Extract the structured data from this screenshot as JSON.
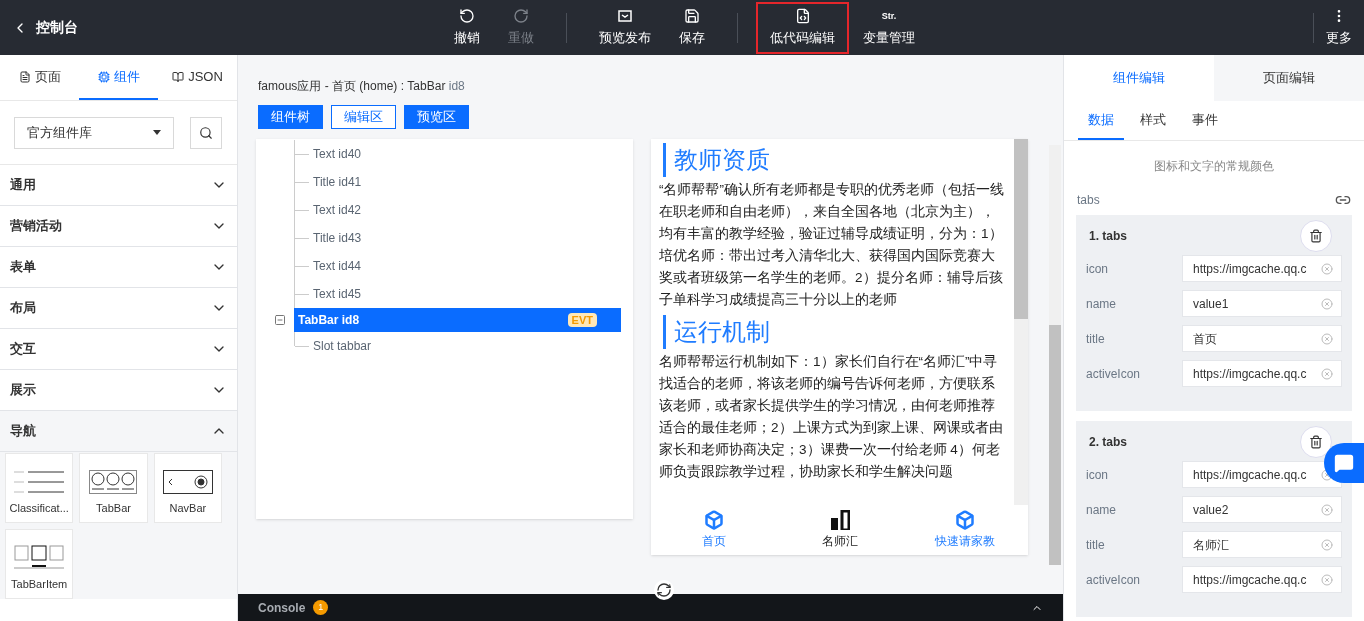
{
  "header": {
    "back_label": "控制台",
    "tools": [
      {
        "label": "撤销",
        "disabled": false,
        "highlighted": false
      },
      {
        "label": "重做",
        "disabled": true,
        "highlighted": false
      },
      {
        "label": "预览发布",
        "disabled": false,
        "highlighted": false
      },
      {
        "label": "保存",
        "disabled": false,
        "highlighted": false
      },
      {
        "label": "低代码编辑",
        "disabled": false,
        "highlighted": true
      },
      {
        "label": "变量管理",
        "icon_text": "Str.",
        "disabled": false,
        "highlighted": false
      }
    ],
    "more_label": "更多"
  },
  "left": {
    "tabs": [
      {
        "label": "页面",
        "selected": false
      },
      {
        "label": "组件",
        "selected": true
      },
      {
        "label": "JSON",
        "selected": false
      }
    ],
    "library_select": "官方组件库",
    "categories": [
      {
        "label": "通用",
        "expanded": false
      },
      {
        "label": "营销活动",
        "expanded": false
      },
      {
        "label": "表单",
        "expanded": false
      },
      {
        "label": "布局",
        "expanded": false
      },
      {
        "label": "交互",
        "expanded": false
      },
      {
        "label": "展示",
        "expanded": false
      },
      {
        "label": "导航",
        "expanded": true,
        "components": [
          {
            "label": "Classificat...",
            "kind": "list"
          },
          {
            "label": "TabBar",
            "kind": "tabbar"
          },
          {
            "label": "NavBar",
            "kind": "navbar"
          },
          {
            "label": "TabBarItem",
            "kind": "tabbaritem"
          }
        ]
      }
    ]
  },
  "center": {
    "breadcrumb_main": "famous应用 - 首页 (home) : TabBar",
    "breadcrumb_id": "id8",
    "view_buttons": [
      {
        "label": "组件树",
        "selected": true
      },
      {
        "label": "编辑区",
        "selected": false
      },
      {
        "label": "预览区",
        "selected": true
      }
    ],
    "tree": [
      {
        "label": "Text id40",
        "selected": false
      },
      {
        "label": "Title id41",
        "selected": false
      },
      {
        "label": "Text id42",
        "selected": false
      },
      {
        "label": "Title id43",
        "selected": false
      },
      {
        "label": "Text id44",
        "selected": false
      },
      {
        "label": "Text id45",
        "selected": false
      },
      {
        "label": "TabBar id8",
        "selected": true,
        "badge": "EVT",
        "expanded": true,
        "children": [
          {
            "label": "Slot tabbar",
            "selected": false
          }
        ]
      }
    ],
    "preview": {
      "sections": [
        {
          "title": "教师资质",
          "text": "“名师帮帮”确认所有老师都是专职的优秀老师（包括一线在职老师和自由老师），来自全国各地（北京为主），均有丰富的教学经验，验证过辅导成绩证明，分为：1）培优名师：带出过考入清华北大、获得国内国际竞赛大奖或者班级第一名学生的老师。2）提分名师：辅导后孩子单科学习成绩提高三十分以上的老师"
        },
        {
          "title": "运行机制",
          "text": "名师帮帮运行机制如下：1）家长们自行在“名师汇”中寻找适合的老师，将该老师的编号告诉何老师，方便联系该老师，或者家长提供学生的学习情况，由何老师推荐适合的最佳老师；2）上课方式为到家上课、网课或者由家长和老师协商决定；3）课费一次一付给老师 4）何老师负责跟踪教学过程，协助家长和学生解决问题"
        }
      ],
      "tabbar": [
        {
          "label": "首页",
          "kind": "cube",
          "selected": true
        },
        {
          "label": "名师汇",
          "kind": "bars",
          "selected": false
        },
        {
          "label": "快速请家教",
          "kind": "cube",
          "selected": true
        }
      ]
    },
    "console": {
      "label": "Console",
      "count": "1"
    }
  },
  "right": {
    "tabs": [
      {
        "label": "组件编辑",
        "selected": true
      },
      {
        "label": "页面编辑",
        "selected": false
      }
    ],
    "subtabs": [
      {
        "label": "数据",
        "selected": true
      },
      {
        "label": "样式",
        "selected": false
      },
      {
        "label": "事件",
        "selected": false
      }
    ],
    "hint": "图标和文字的常规颜色",
    "list_label": "tabs",
    "groups": [
      {
        "title": "1. tabs",
        "fields": [
          {
            "label": "icon",
            "value": "https://imgcache.qq.c"
          },
          {
            "label": "name",
            "value": "value1"
          },
          {
            "label": "title",
            "value": "首页"
          },
          {
            "label": "activeIcon",
            "value": "https://imgcache.qq.c"
          }
        ]
      },
      {
        "title": "2. tabs",
        "fields": [
          {
            "label": "icon",
            "value": "https://imgcache.qq.c"
          },
          {
            "label": "name",
            "value": "value2"
          },
          {
            "label": "title",
            "value": "名师汇"
          },
          {
            "label": "activeIcon",
            "value": "https://imgcache.qq.c"
          }
        ]
      }
    ]
  }
}
